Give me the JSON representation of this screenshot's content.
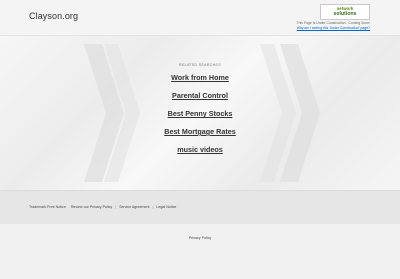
{
  "header": {
    "site_title": "Clayson.org",
    "logo": {
      "line1": "network",
      "line2": "solutions",
      "accent_color": "#4f8a10"
    },
    "under_construction": {
      "notice": "This Page Is Under Construction - Coming Soon!",
      "link": "Why am I seeing this 'Under Construction' page?"
    }
  },
  "main": {
    "related_heading": "RELATED SEARCHES",
    "searches": [
      "Work from Home",
      "Parental Control",
      "Best Penny Stocks",
      "Best Mortgage Rates",
      "music videos"
    ]
  },
  "footer": {
    "trademark": "Trademark Free Notice",
    "review_privacy": "Review our Privacy Policy",
    "service_agreement": "Service Agreement",
    "legal_notice": "Legal Notice",
    "privacy_policy": "Privacy Policy"
  },
  "colors": {
    "link": "#0066cc",
    "text": "#333333",
    "chevron": "#dcdcdc"
  }
}
